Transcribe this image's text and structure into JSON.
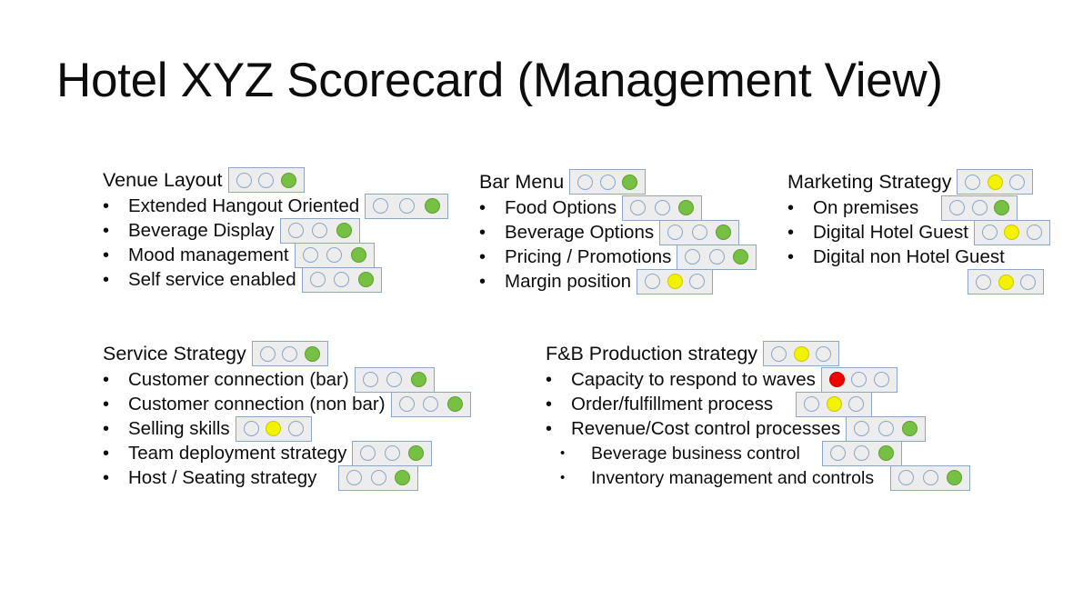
{
  "slide": {
    "title": "Hotel XYZ Scorecard (Management View)",
    "background_color": "#ffffff"
  },
  "legend_colors": {
    "green": "#76c043",
    "yellow": "#f3f300",
    "red": "#ee0000",
    "empty": "#ededed",
    "box_border": "#8ca6c6",
    "box_fill": "#ededed"
  },
  "sections": [
    {
      "id": "venue-layout",
      "heading": "Venue Layout",
      "heading_status": "green",
      "items": [
        {
          "label": "Extended Hangout Oriented",
          "status": "green",
          "level": 1
        },
        {
          "label": "Beverage Display",
          "status": "green",
          "level": 1
        },
        {
          "label": "Mood management",
          "status": "green",
          "level": 1
        },
        {
          "label": "Self service enabled",
          "status": "green",
          "level": 1
        }
      ]
    },
    {
      "id": "bar-menu",
      "heading": "Bar Menu",
      "heading_status": "green",
      "items": [
        {
          "label": "Food Options",
          "status": "green",
          "level": 1
        },
        {
          "label": "Beverage Options",
          "status": "green",
          "level": 1
        },
        {
          "label": "Pricing / Promotions",
          "status": "green",
          "level": 1
        },
        {
          "label": "Margin position",
          "status": "yellow",
          "level": 1
        }
      ]
    },
    {
      "id": "marketing-strategy",
      "heading": "Marketing Strategy",
      "heading_status": "yellow",
      "items": [
        {
          "label": "On premises",
          "status": "green",
          "level": 1
        },
        {
          "label": "Digital Hotel Guest",
          "status": "yellow",
          "level": 1
        },
        {
          "label": "Digital non Hotel Guest",
          "status": "yellow",
          "level": 1,
          "indicator_wrapped": true
        }
      ]
    },
    {
      "id": "service-strategy",
      "heading": "Service Strategy",
      "heading_status": "green",
      "items": [
        {
          "label": "Customer connection (bar)",
          "status": "green",
          "level": 1
        },
        {
          "label": "Customer connection (non bar)",
          "status": "green",
          "level": 1
        },
        {
          "label": "Selling skills",
          "status": "yellow",
          "level": 1
        },
        {
          "label": "Team deployment strategy",
          "status": "green",
          "level": 1
        },
        {
          "label": "Host / Seating strategy",
          "status": "green",
          "level": 1
        }
      ]
    },
    {
      "id": "fnb-production-strategy",
      "heading": "F&B Production strategy",
      "heading_status": "yellow",
      "items": [
        {
          "label": "Capacity to respond to waves",
          "status": "red",
          "level": 1
        },
        {
          "label": "Order/fulfillment process",
          "status": "yellow",
          "level": 1
        },
        {
          "label": "Revenue/Cost control processes",
          "status": "green",
          "level": 1
        },
        {
          "label": "Beverage business control",
          "status": "green",
          "level": 2
        },
        {
          "label": "Inventory management and controls",
          "status": "green",
          "level": 2
        }
      ]
    }
  ],
  "bullet_glyph": "•"
}
